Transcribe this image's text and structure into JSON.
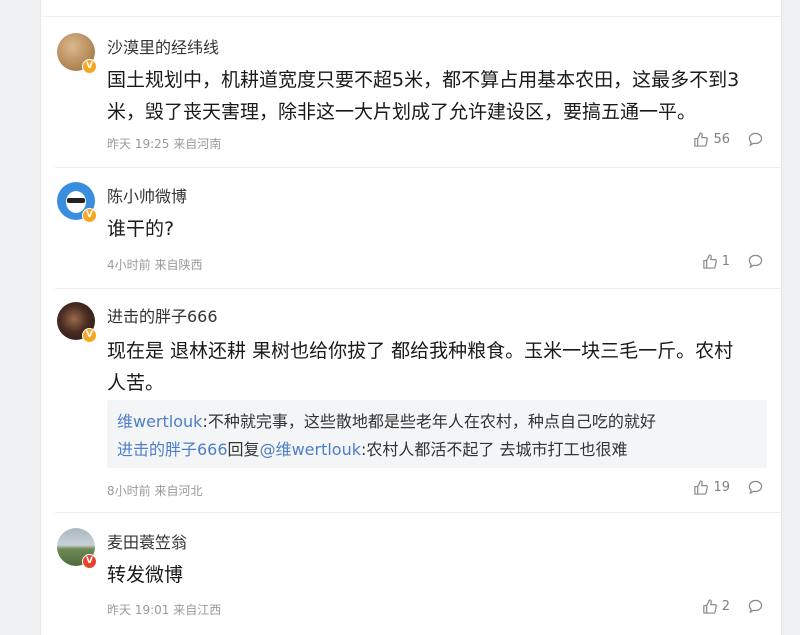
{
  "comments": [
    {
      "username": "沙漠里的经纬线",
      "content": "国土规划中，机耕道宽度只要不超5米，都不算占用基本农田，这最多不到3米，毁了丧天害理，除非这一大片划成了允许建设区，要搞五通一平。",
      "content_line1": "国土规划中，机耕道宽度只要不超5米，都不算占用基本农田，这最多不到3",
      "content_line2": "米，毁了丧天害理，除非这一大片划成了允许建设区，要搞五通一平。",
      "meta": "昨天 19:25 来自河南",
      "likes": "56",
      "badge": "V"
    },
    {
      "username": "陈小帅微博",
      "content": "谁干的?",
      "meta": "4小时前 来自陕西",
      "likes": "1",
      "badge": "V"
    },
    {
      "username": "进击的胖子666",
      "content_line1": "现在是 退林还耕 果树也给你拔了 都给我种粮食。玉米一块三毛一斤。农村",
      "content_line2": "人苦。",
      "replies": [
        {
          "user": "维wertlouk",
          "text": ":不种就完事，这些散地都是些老年人在农村，种点自己吃的就好"
        },
        {
          "user": "进击的胖子666",
          "mid": "回复",
          "target": "@维wertlouk",
          "text": ":农村人都活不起了 去城市打工也很难"
        }
      ],
      "meta": "8小时前 来自河北",
      "likes": "19",
      "badge": "V"
    },
    {
      "username": "麦田蓑笠翁",
      "content": "转发微博",
      "meta": "昨天 19:01 来自江西",
      "likes": "2",
      "badge": "V"
    }
  ],
  "icons": {
    "like": "thumbs-up-icon",
    "reply": "comment-bubble-icon"
  },
  "colors": {
    "link": "#4c7fc6",
    "badge_gold": "#f5a623",
    "badge_red": "#e6432e"
  }
}
